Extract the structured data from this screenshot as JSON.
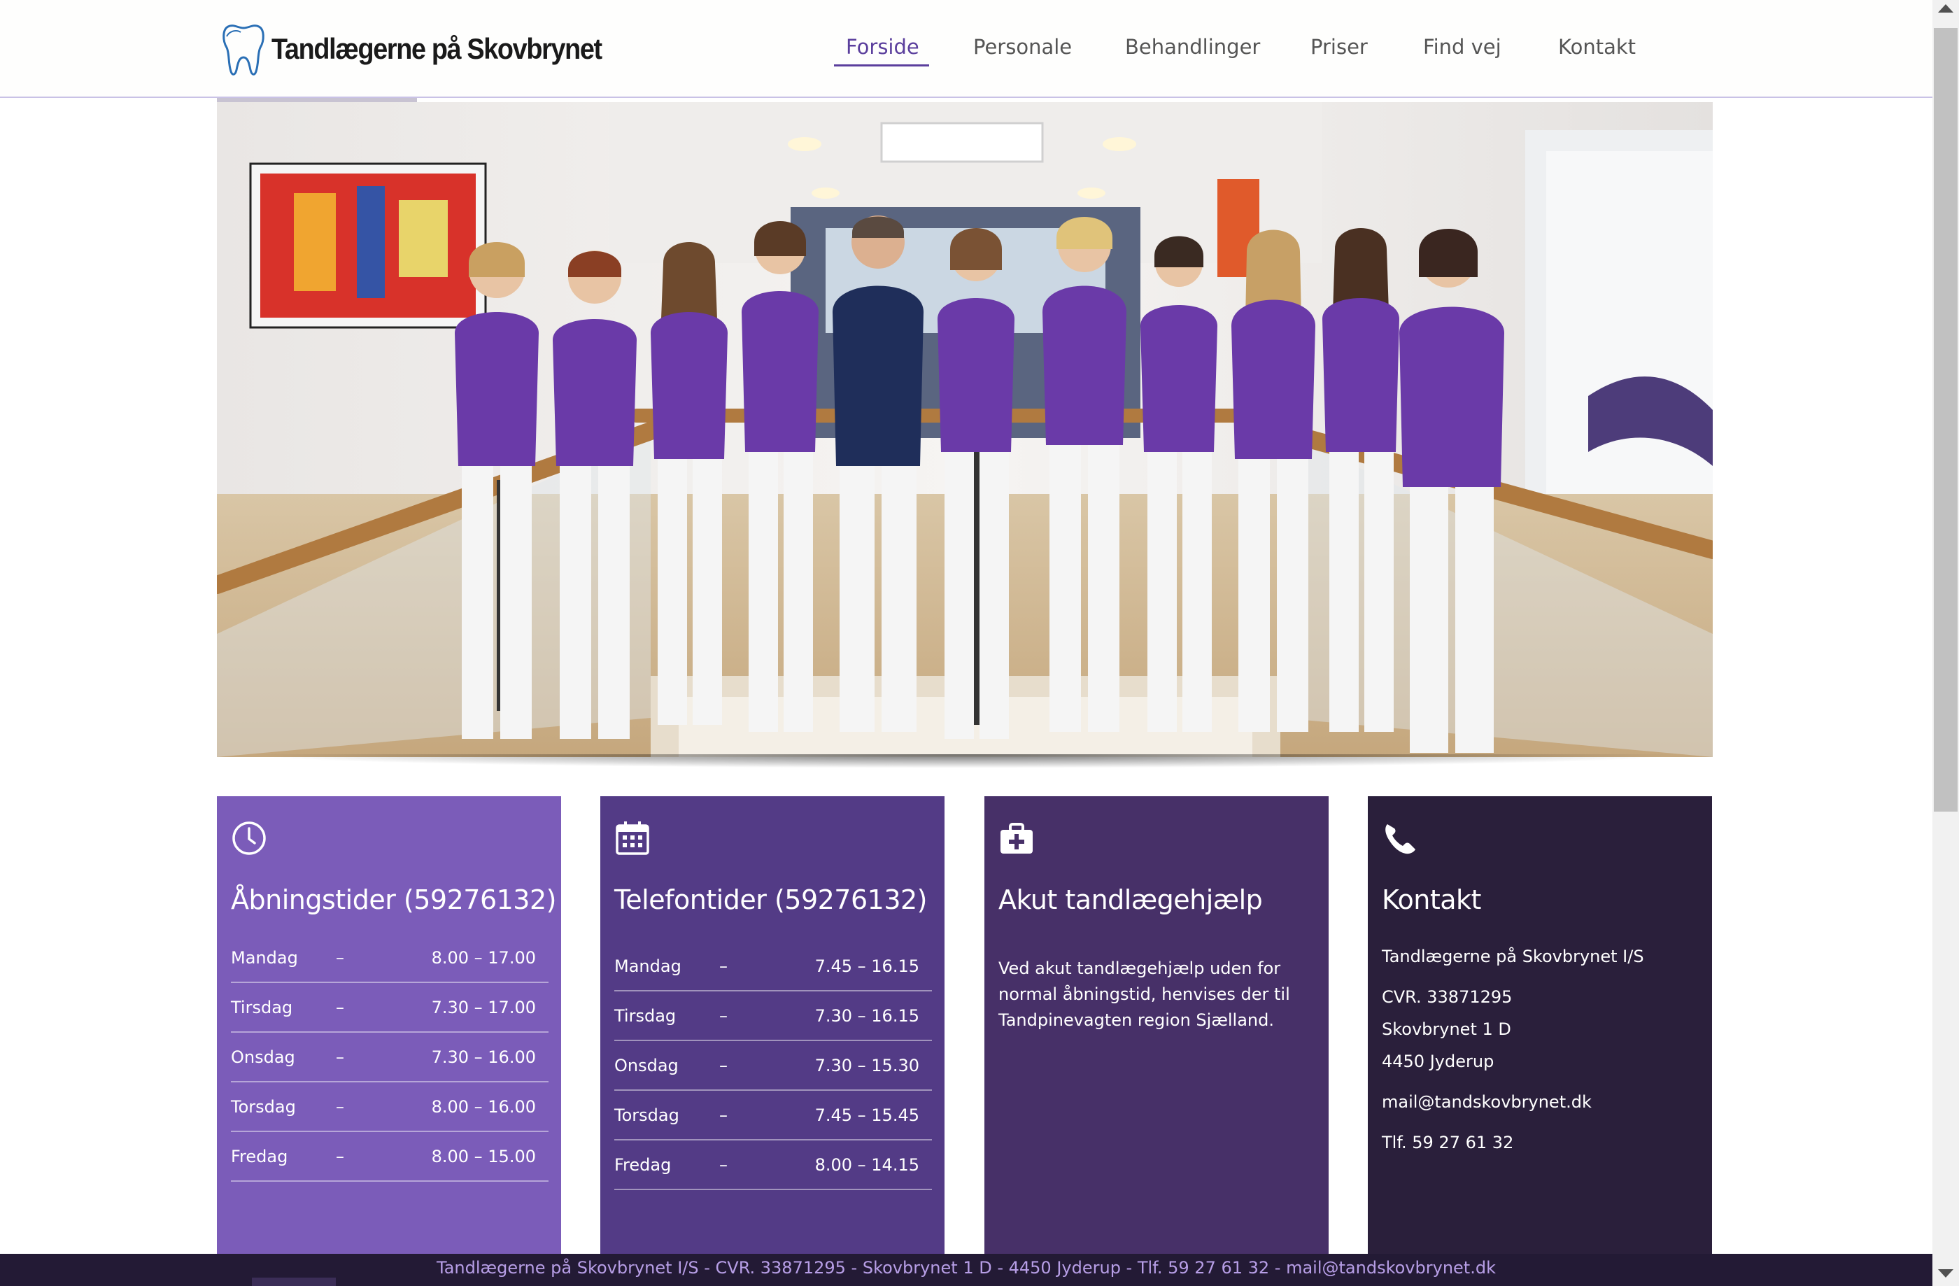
{
  "header": {
    "logo_text": "Tandlægerne på Skovbrynet",
    "nav": [
      {
        "label": "Forside",
        "active": true
      },
      {
        "label": "Personale"
      },
      {
        "label": "Behandlinger"
      },
      {
        "label": "Priser"
      },
      {
        "label": "Find vej"
      },
      {
        "label": "Kontakt"
      }
    ]
  },
  "hero": {
    "icon": "team-photo"
  },
  "cards": {
    "opening": {
      "icon": "clock-icon",
      "title": "Åbningstider (59276132)",
      "rows": [
        {
          "day": "Mandag",
          "dash": "–",
          "time": "8.00 – 17.00"
        },
        {
          "day": "Tirsdag",
          "dash": "–",
          "time": "7.30 – 17.00"
        },
        {
          "day": "Onsdag",
          "dash": "–",
          "time": "7.30 – 16.00"
        },
        {
          "day": "Torsdag",
          "dash": "–",
          "time": "8.00 – 16.00"
        },
        {
          "day": "Fredag",
          "dash": "–",
          "time": "8.00 – 15.00"
        }
      ]
    },
    "phone_hours": {
      "icon": "calendar-icon",
      "title": "Telefontider (59276132)",
      "rows": [
        {
          "day": "Mandag",
          "dash": "–",
          "time": "7.45 – 16.15"
        },
        {
          "day": "Tirsdag",
          "dash": "–",
          "time": "7.30 – 16.15"
        },
        {
          "day": "Onsdag",
          "dash": "–",
          "time": "7.30 – 15.30"
        },
        {
          "day": "Torsdag",
          "dash": "–",
          "time": "7.45 – 15.45"
        },
        {
          "day": "Fredag",
          "dash": "–",
          "time": "8.00 – 14.15"
        }
      ]
    },
    "emergency": {
      "icon": "medkit-icon",
      "title": "Akut tandlægehjælp",
      "text": "Ved akut tandlægehjælp uden for normal åbningstid, henvises der til Tandpinevagten region Sjælland."
    },
    "contact": {
      "icon": "phone-icon",
      "title": "Kontakt",
      "company": "Tandlægerne på Skovbrynet I/S",
      "cvr": "CVR. 33871295",
      "street": "Skovbrynet 1 D",
      "city": "4450 Jyderup",
      "email": "mail@tandskovbrynet.dk",
      "phone": "Tlf. 59 27 61 32"
    }
  },
  "footer": {
    "text": "Tandlægerne på Skovbrynet I/S - CVR. 33871295 - Skovbrynet 1 D - 4450 Jyderup - Tlf. 59 27 61 32 - mail@tandskovbrynet.dk"
  },
  "colors": {
    "accent": "#5b3f9d",
    "card1": "#7b5cb9",
    "card2": "#533b86",
    "card3": "#473068",
    "card4": "#2a1f3b",
    "footer_bg": "#231a35",
    "footer_text": "#b79ee6"
  }
}
